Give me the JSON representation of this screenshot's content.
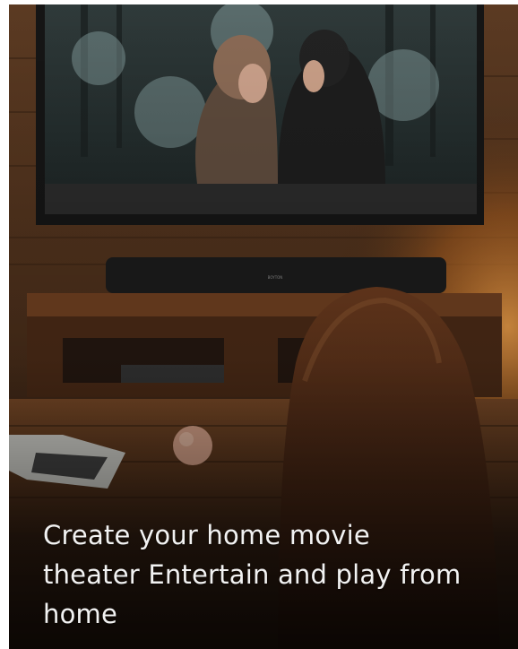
{
  "caption": {
    "text": "Create your home movie theater Entertain and play from home"
  },
  "scene": {
    "description_icon": "living-room-photo",
    "tv_brand": "BOYTON"
  }
}
